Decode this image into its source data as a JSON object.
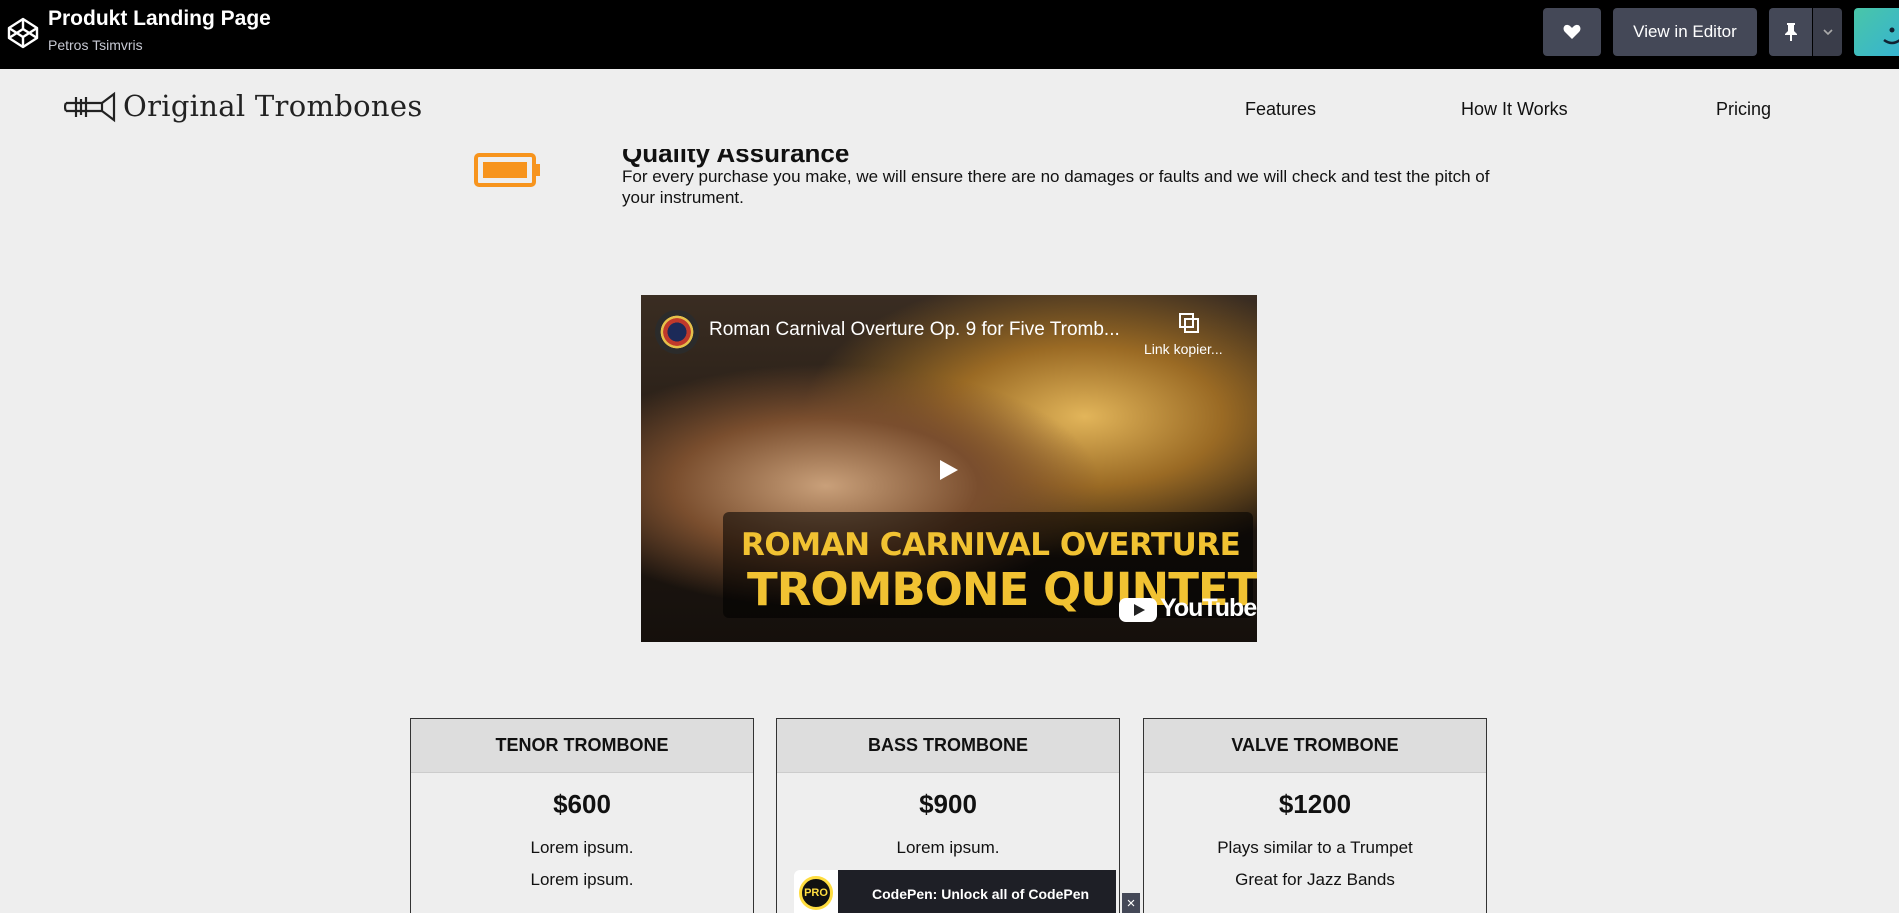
{
  "codepen": {
    "title": "Produkt Landing Page",
    "author": "Petros Tsimvris",
    "view_in_editor": "View in Editor",
    "heart_icon": "heart-icon",
    "pin_icon": "pin-icon"
  },
  "site": {
    "brand": "Original Trombones",
    "nav": [
      "Features",
      "How It Works",
      "Pricing"
    ]
  },
  "feature": {
    "title": "Quality Assurance",
    "text": "For every purchase you make, we will ensure there are no damages or faults and we will check and test the pitch of your instrument.",
    "icon": "battery-icon",
    "icon_color": "#f7941d"
  },
  "video": {
    "title": "Roman Carnival Overture Op. 9 for Five Tromb...",
    "copy_label": "Link kopier...",
    "banner_line1": "ROMAN CARNIVAL OVERTURE",
    "banner_line2": "TROMBONE QUINTET",
    "provider": "YouTube"
  },
  "pricing": [
    {
      "name": "TENOR TROMBONE",
      "price": "$600",
      "features": [
        "Lorem ipsum.",
        "Lorem ipsum."
      ]
    },
    {
      "name": "BASS TROMBONE",
      "price": "$900",
      "features": [
        "Lorem ipsum."
      ]
    },
    {
      "name": "VALVE TROMBONE",
      "price": "$1200",
      "features": [
        "Plays similar to a Trumpet",
        "Great for Jazz Bands"
      ]
    }
  ],
  "pro_banner": {
    "badge": "PRO",
    "text": "CodePen: Unlock all of CodePen",
    "close": "×"
  }
}
